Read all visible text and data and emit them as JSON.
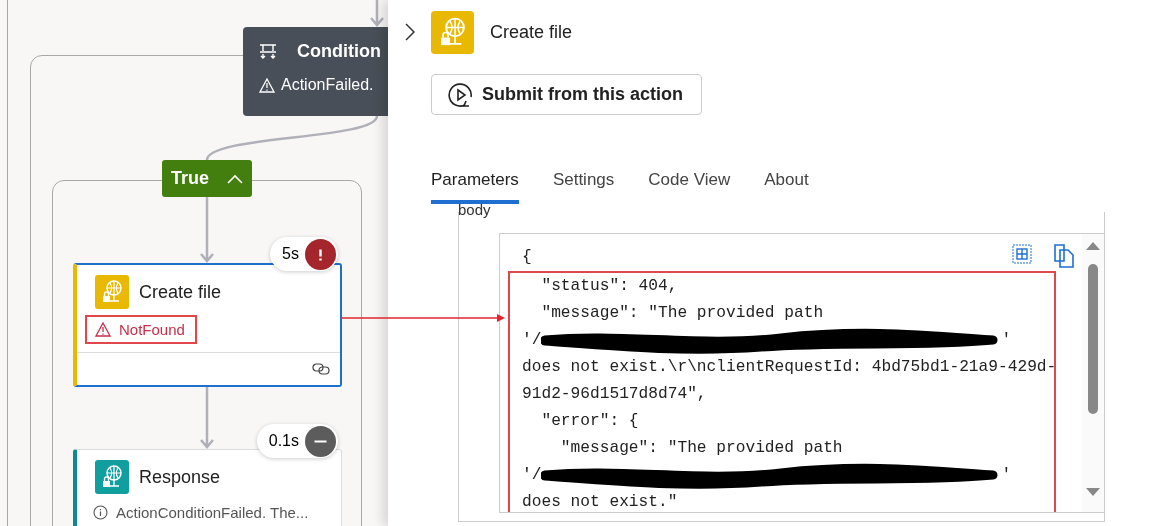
{
  "canvas": {
    "condition": {
      "title": "Condition",
      "status": "ActionFailed."
    },
    "branch": {
      "label": "True",
      "expanded": true
    },
    "actions": [
      {
        "kind": "file",
        "title": "Create file",
        "duration": "5s",
        "failed": true,
        "message": "NotFound",
        "selected": true,
        "highlighted": true
      },
      {
        "kind": "response",
        "title": "Response",
        "duration": "0.1s",
        "failed": false,
        "message": "ActionConditionFailed. The...",
        "selected": false,
        "highlighted": false
      }
    ]
  },
  "panel": {
    "title": "Create file",
    "button": "Submit from this action",
    "tabs": [
      {
        "label": "Parameters",
        "selected": true
      },
      {
        "label": "Settings",
        "selected": false
      },
      {
        "label": "Code View",
        "selected": false
      },
      {
        "label": "About",
        "selected": false
      }
    ],
    "section_label": "body",
    "code_lines": [
      {
        "kind": "text",
        "text": "{",
        "highlighted": false
      },
      {
        "kind": "text",
        "text": "  \"status\": 404,",
        "highlighted": true
      },
      {
        "kind": "text",
        "text": "  \"message\": \"The provided path",
        "highlighted": true
      },
      {
        "kind": "redacted",
        "text": "'/",
        "end": "'",
        "highlighted": true
      },
      {
        "kind": "text",
        "text": "does not exist.\\r\\nclientRequestId: 4bd75bd1-21a9-429d-",
        "highlighted": true
      },
      {
        "kind": "text",
        "text": "91d2-96d1517d8d74\",",
        "highlighted": true
      },
      {
        "kind": "text",
        "text": "  \"error\": {",
        "highlighted": true
      },
      {
        "kind": "text",
        "text": "    \"message\": \"The provided path",
        "highlighted": true
      },
      {
        "kind": "redacted",
        "text": "'/",
        "end": "'",
        "highlighted": true
      },
      {
        "kind": "text",
        "text": "does not exist.\"",
        "highlighted": true
      }
    ]
  }
}
